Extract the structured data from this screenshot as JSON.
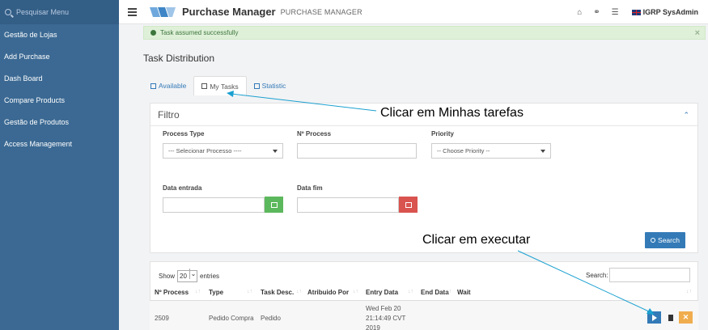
{
  "sidebar": {
    "search_placeholder": "Pesquisar Menu",
    "items": [
      {
        "label": "Gestão de Lojas"
      },
      {
        "label": "Add Purchase"
      },
      {
        "label": "Dash Board"
      },
      {
        "label": "Compare Products"
      },
      {
        "label": "Gestão de Produtos"
      },
      {
        "label": "Access Management"
      }
    ]
  },
  "header": {
    "title": "Purchase Manager",
    "subtitle": "PURCHASE MANAGER",
    "user": "IGRP SysAdmin"
  },
  "alert": {
    "message": "Task assumed successfully",
    "close": "×"
  },
  "page": {
    "title": "Task Distribution"
  },
  "tabs": [
    {
      "label": "Available"
    },
    {
      "label": "My Tasks"
    },
    {
      "label": "Statistic"
    }
  ],
  "filter": {
    "title": "Filtro",
    "process_type_label": "Process Type",
    "process_type_value": "--- Selecionar Processo ----",
    "process_no_label": "Nº Process",
    "priority_label": "Priority",
    "priority_value": "-- Choose Priority --",
    "date_start_label": "Data entrada",
    "date_end_label": "Data fim",
    "search_button": "Search"
  },
  "table": {
    "show_label": "Show",
    "page_length": "20",
    "entries_label": "entries",
    "search_label": "Search:",
    "columns": [
      "Nº Process",
      "Type",
      "Task Desc.",
      "Atribuido Por",
      "Entry Data",
      "End Data",
      "Wait"
    ],
    "rows": [
      {
        "process": "2509",
        "type": "Pedido Compra",
        "desc": "Pedido",
        "assigned": "",
        "entry_line1": "Wed Feb 20",
        "entry_line2": "21:14:49 CVT",
        "entry_line3": "2019",
        "end": "",
        "wait": ""
      }
    ]
  },
  "annotations": {
    "my_tasks": "Clicar em Minhas tarefas",
    "execute": "Clicar em executar"
  },
  "colors": {
    "sidebar": "#3b6993",
    "primary": "#337ab7",
    "success_bg": "#dff0d8",
    "calendar_green": "#5cb85c",
    "calendar_red": "#d9534f",
    "warning": "#f0ad4e"
  }
}
